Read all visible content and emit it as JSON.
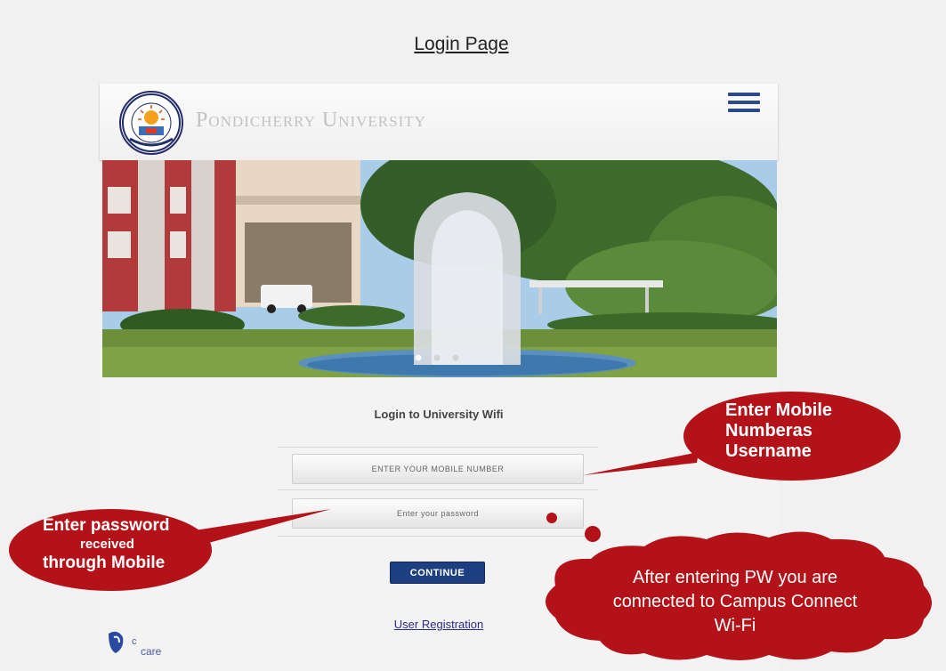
{
  "page_title": "Login Page",
  "header": {
    "university_name": "Pondicherry University",
    "logo_icon": "university-seal-icon",
    "menu_icon": "hamburger-menu-icon"
  },
  "carousel": {
    "slide_count": 3,
    "active_slide": 1
  },
  "login": {
    "heading": "Login to University Wifi",
    "mobile_placeholder": "ENTER YOUR MOBILE NUMBER",
    "password_placeholder": "Enter your password",
    "continue_label": "CONTINUE",
    "registration_link": "User Registration"
  },
  "footer_logo_text": "care",
  "annotations": {
    "mobile_callout": [
      "Enter Mobile",
      "Numberas",
      "Username"
    ],
    "password_callout": {
      "line1": "Enter password",
      "line2": "received",
      "line3": "through Mobile"
    },
    "connected_callout": [
      "After entering PW  you are",
      "connected to Campus Connect",
      "Wi-Fi"
    ]
  },
  "colors": {
    "callout_fill": "#b31218",
    "button_blue": "#1d3f80",
    "menu_blue": "#2c4a8a",
    "link_blue": "#2a2a88"
  }
}
